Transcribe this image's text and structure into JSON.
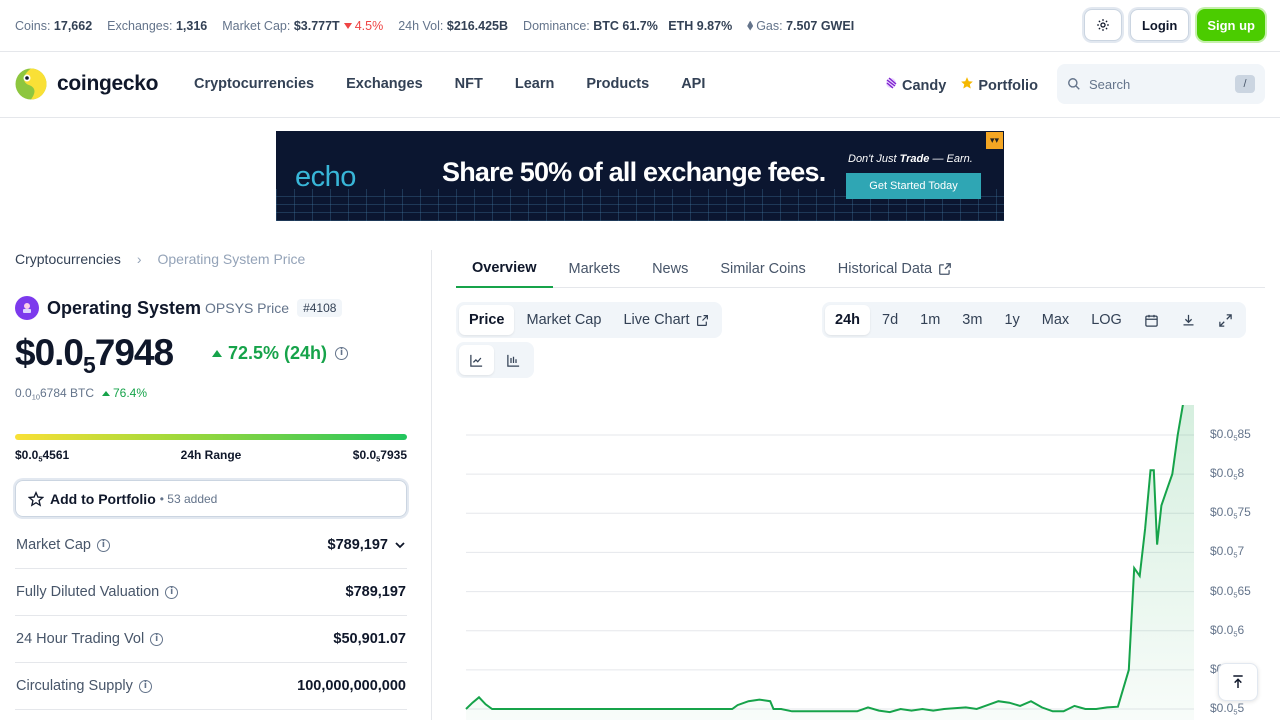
{
  "statbar": {
    "coins_label": "Coins:",
    "coins": "17,662",
    "exchanges_label": "Exchanges:",
    "exchanges": "1,316",
    "mcap_label": "Market Cap:",
    "mcap": "$3.777T",
    "mcap_change": "4.5%",
    "vol_label": "24h Vol:",
    "vol": "$216.425B",
    "dominance_label": "Dominance:",
    "btc_dom": "BTC 61.7%",
    "eth_dom": "ETH 9.87%",
    "gas_label": "Gas:",
    "gas": "7.507 GWEI",
    "login": "Login",
    "signup": "Sign up"
  },
  "nav": {
    "brand": "coingecko",
    "menu": [
      "Cryptocurrencies",
      "Exchanges",
      "NFT",
      "Learn",
      "Products",
      "API"
    ],
    "candy": "Candy",
    "portfolio": "Portfolio",
    "search_placeholder": "Search",
    "search_shortcut": "/"
  },
  "ad": {
    "brand": "echo",
    "headline": "Share 50% of all exchange fees.",
    "tagline_pre": "Don't Just ",
    "tagline_bold": "Trade",
    "tagline_post": " — Earn.",
    "cta": "Get Started Today"
  },
  "coin": {
    "breadcrumb_root": "Cryptocurrencies",
    "breadcrumb_current": "Operating System Price",
    "name": "Operating System",
    "symbol_label": "OPSYS Price",
    "rank": "#4108",
    "price_prefix": "$0.0",
    "price_zeros": "5",
    "price_digits": "7948",
    "change_24h": "72.5% (24h)",
    "btc_prefix": "0.0",
    "btc_zeros": "10",
    "btc_digits": "6784 BTC",
    "btc_change": "76.4%",
    "range_low_prefix": "$0.0",
    "range_low_zeros": "5",
    "range_low_digits": "4561",
    "range_label": "24h Range",
    "range_high_prefix": "$0.0",
    "range_high_zeros": "5",
    "range_high_digits": "7935",
    "range_position": 1.0,
    "add_portfolio": "Add to Portfolio",
    "added_count": "• 53 added"
  },
  "stats": [
    {
      "label": "Market Cap",
      "value": "$789,197"
    },
    {
      "label": "Fully Diluted Valuation",
      "value": "$789,197"
    },
    {
      "label": "24 Hour Trading Vol",
      "value": "$50,901.07"
    },
    {
      "label": "Circulating Supply",
      "value": "100,000,000,000"
    }
  ],
  "tabs": [
    "Overview",
    "Markets",
    "News",
    "Similar Coins",
    "Historical Data"
  ],
  "chart_controls": {
    "type_options": [
      "Price",
      "Market Cap",
      "Live Chart"
    ],
    "range_options": [
      "24h",
      "7d",
      "1m",
      "3m",
      "1y",
      "Max",
      "LOG"
    ]
  },
  "chart_data": {
    "type": "area",
    "color": "#16a34a",
    "ytick_labels": [
      "$0.0₅85",
      "$0.0₅8",
      "$0.0₅75",
      "$0.0₅7",
      "$0.0₅65",
      "$0.0₅6",
      "$0.0₅55",
      "$0.0₅5"
    ],
    "yticks": [
      8.5,
      8.0,
      7.5,
      7.0,
      6.5,
      6.0,
      5.5,
      5.0
    ],
    "ylim": [
      4.85,
      8.7
    ],
    "series": [
      {
        "values": [
          [
            0,
            5.0
          ],
          [
            0.6,
            5.08
          ],
          [
            1.2,
            5.15
          ],
          [
            1.8,
            5.06
          ],
          [
            2.4,
            5.0
          ],
          [
            3.0,
            5.0
          ],
          [
            20,
            5.0
          ],
          [
            24.5,
            5.0
          ],
          [
            25,
            5.05
          ],
          [
            26,
            5.1
          ],
          [
            27,
            5.12
          ],
          [
            28,
            5.1
          ],
          [
            28.3,
            5.0
          ],
          [
            29,
            5.0
          ],
          [
            30,
            4.97
          ],
          [
            36,
            4.97
          ],
          [
            37,
            5.02
          ],
          [
            38,
            4.98
          ],
          [
            39,
            4.96
          ],
          [
            40,
            5.0
          ],
          [
            41,
            4.98
          ],
          [
            42,
            5.0
          ],
          [
            43,
            4.98
          ],
          [
            44,
            5.0
          ],
          [
            46,
            5.02
          ],
          [
            47,
            5.0
          ],
          [
            48,
            5.05
          ],
          [
            49,
            5.1
          ],
          [
            50,
            5.08
          ],
          [
            51,
            5.04
          ],
          [
            52,
            5.1
          ],
          [
            53,
            5.02
          ],
          [
            54,
            4.97
          ],
          [
            55,
            4.97
          ],
          [
            56,
            5.04
          ],
          [
            57,
            5.0
          ],
          [
            58,
            5.0
          ],
          [
            59,
            5.02
          ],
          [
            60,
            5.03
          ],
          [
            61,
            5.5
          ],
          [
            61.5,
            6.8
          ],
          [
            62,
            6.7
          ],
          [
            62.5,
            7.3
          ],
          [
            63,
            8.05
          ],
          [
            63.3,
            8.05
          ],
          [
            63.6,
            7.1
          ],
          [
            64,
            7.6
          ],
          [
            64.5,
            7.8
          ],
          [
            65,
            8.0
          ],
          [
            65.5,
            8.5
          ],
          [
            66,
            8.9
          ],
          [
            67,
            8.9
          ]
        ]
      }
    ]
  }
}
